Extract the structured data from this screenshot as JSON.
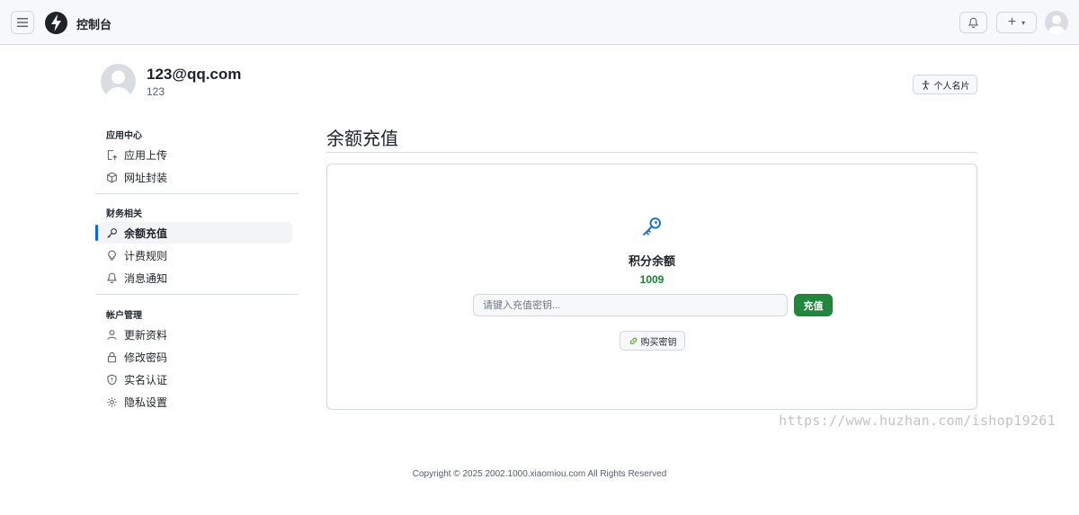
{
  "header": {
    "app_title": "控制台",
    "menu_icon": "hamburger-icon",
    "logo_icon": "lightning-bolt-icon",
    "bell_icon": "bell-icon",
    "plus_label": "+",
    "caret_label": "▾"
  },
  "profile": {
    "email": "123@qq.com",
    "username": "123",
    "card_button_label": "个人名片"
  },
  "sidebar": {
    "sections": [
      {
        "title": "应用中心",
        "items": [
          {
            "label": "应用上传",
            "icon": "upload-icon"
          },
          {
            "label": "网址封装",
            "icon": "package-icon"
          }
        ]
      },
      {
        "title": "财务相关",
        "items": [
          {
            "label": "余额充值",
            "icon": "key-icon",
            "active": true
          },
          {
            "label": "计费规则",
            "icon": "lightbulb-icon"
          },
          {
            "label": "消息通知",
            "icon": "bell-icon"
          }
        ]
      },
      {
        "title": "帐户管理",
        "items": [
          {
            "label": "更新资料",
            "icon": "person-icon"
          },
          {
            "label": "修改密码",
            "icon": "lock-icon"
          },
          {
            "label": "实名认证",
            "icon": "shield-icon"
          },
          {
            "label": "隐私设置",
            "icon": "gear-icon"
          }
        ]
      }
    ]
  },
  "main": {
    "page_title": "余额充值",
    "balance_label": "积分余额",
    "balance_value": "1009",
    "key_input_placeholder": "请键入充值密钥...",
    "key_input_value": "",
    "recharge_button_label": "充值",
    "buy_button_label": "购买密钥"
  },
  "watermark": "https://www.huzhan.com/ishop19261",
  "footer": "Copyright © 2025 2002.1000.xiaomiou.com All Rights Reserved",
  "colors": {
    "accent_blue": "#0969da",
    "success_green": "#1f883d",
    "balance_green": "#1a7f37"
  }
}
